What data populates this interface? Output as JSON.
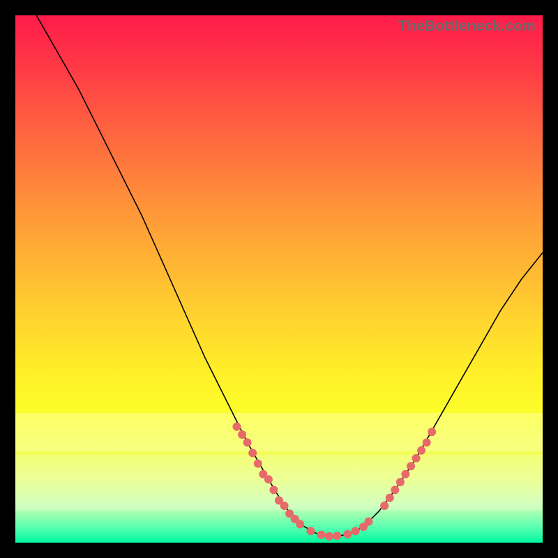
{
  "watermark": "TheBottleneck.com",
  "colors": {
    "background": "#000000",
    "gradient_top": "#ff1b4a",
    "gradient_bottom": "#00f8a0",
    "curve": "#000000",
    "marker": "#e76a6a"
  },
  "chart_data": {
    "type": "line",
    "title": "",
    "xlabel": "",
    "ylabel": "",
    "xlim": [
      0,
      100
    ],
    "ylim": [
      0,
      100
    ],
    "grid": false,
    "curve": [
      {
        "x": 4,
        "y": 100
      },
      {
        "x": 8,
        "y": 93
      },
      {
        "x": 12,
        "y": 86
      },
      {
        "x": 16,
        "y": 78
      },
      {
        "x": 20,
        "y": 70
      },
      {
        "x": 24,
        "y": 62
      },
      {
        "x": 28,
        "y": 53
      },
      {
        "x": 32,
        "y": 44
      },
      {
        "x": 36,
        "y": 35
      },
      {
        "x": 40,
        "y": 27
      },
      {
        "x": 44,
        "y": 19
      },
      {
        "x": 48,
        "y": 12
      },
      {
        "x": 51,
        "y": 7
      },
      {
        "x": 54,
        "y": 3.5
      },
      {
        "x": 57,
        "y": 1.8
      },
      {
        "x": 60,
        "y": 1.2
      },
      {
        "x": 63,
        "y": 1.5
      },
      {
        "x": 66,
        "y": 3
      },
      {
        "x": 69,
        "y": 6
      },
      {
        "x": 72,
        "y": 10
      },
      {
        "x": 76,
        "y": 16
      },
      {
        "x": 80,
        "y": 23
      },
      {
        "x": 84,
        "y": 30
      },
      {
        "x": 88,
        "y": 37
      },
      {
        "x": 92,
        "y": 44
      },
      {
        "x": 96,
        "y": 50
      },
      {
        "x": 100,
        "y": 55
      }
    ],
    "markers": [
      {
        "x": 42,
        "y": 22
      },
      {
        "x": 43,
        "y": 20.5
      },
      {
        "x": 44,
        "y": 19
      },
      {
        "x": 45,
        "y": 17
      },
      {
        "x": 46,
        "y": 15
      },
      {
        "x": 47,
        "y": 13
      },
      {
        "x": 48,
        "y": 12
      },
      {
        "x": 49,
        "y": 10
      },
      {
        "x": 50,
        "y": 8
      },
      {
        "x": 51,
        "y": 7
      },
      {
        "x": 52,
        "y": 5.5
      },
      {
        "x": 53,
        "y": 4.5
      },
      {
        "x": 54,
        "y": 3.5
      },
      {
        "x": 56,
        "y": 2.2
      },
      {
        "x": 58,
        "y": 1.5
      },
      {
        "x": 59.5,
        "y": 1.2
      },
      {
        "x": 61,
        "y": 1.3
      },
      {
        "x": 63,
        "y": 1.6
      },
      {
        "x": 64.5,
        "y": 2.2
      },
      {
        "x": 66,
        "y": 3
      },
      {
        "x": 67,
        "y": 4
      },
      {
        "x": 70,
        "y": 7
      },
      {
        "x": 71,
        "y": 8.5
      },
      {
        "x": 72,
        "y": 10
      },
      {
        "x": 73,
        "y": 11.5
      },
      {
        "x": 74,
        "y": 13
      },
      {
        "x": 75,
        "y": 14.5
      },
      {
        "x": 76,
        "y": 16
      },
      {
        "x": 77,
        "y": 17.5
      },
      {
        "x": 78,
        "y": 19
      },
      {
        "x": 79,
        "y": 21
      }
    ],
    "marker_radius_px": 6
  }
}
